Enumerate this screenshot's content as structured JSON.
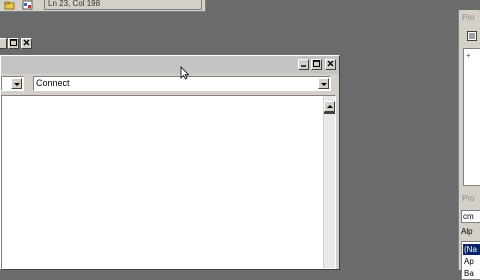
{
  "status_bar": {
    "position": "Ln 23, Col 198"
  },
  "main_window": {
    "combo_left_value": "",
    "combo_right_value": "Connect"
  },
  "properties_panel": {
    "title_fragment": "Pro",
    "list_item_prefix": "+",
    "section_title_fragment": "Pro",
    "object_combo_value": "cm",
    "tab_label": "Alp",
    "rows": [
      "(Na",
      "Ap",
      "Ba"
    ]
  },
  "colors": {
    "desktop": "#6b6b6b",
    "face": "#d4d0c8",
    "selection": "#0a246a"
  }
}
